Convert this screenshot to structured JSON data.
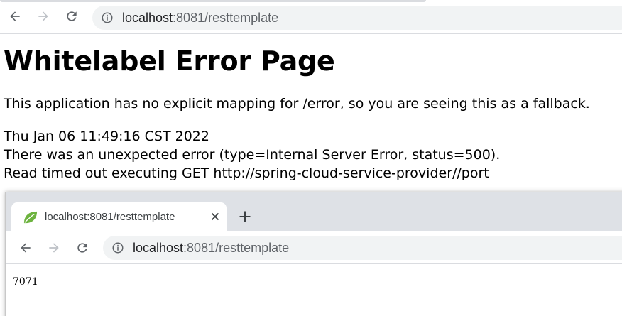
{
  "browser": {
    "url_host": "localhost",
    "url_rest": ":8081/resttemplate"
  },
  "page": {
    "title": "Whitelabel Error Page",
    "intro": "This application has no explicit mapping for /error, so you are seeing this as a fallback.",
    "timestamp": "Thu Jan 06 11:49:16 CST 2022",
    "error_line": "There was an unexpected error (type=Internal Server Error, status=500).",
    "message": "Read timed out executing GET http://spring-cloud-service-provider//port"
  },
  "second_window": {
    "tab_title": "localhost:8081/resttemplate",
    "url_host": "localhost",
    "url_rest": ":8081/resttemplate",
    "body_text": "7071"
  },
  "colors": {
    "icon": "#5f6368",
    "icon_disabled": "#bdc1c6",
    "omnibox": "#f1f3f4",
    "tabstrip": "#dee1e6",
    "spring_leaf": "#6db33f"
  },
  "icons": [
    "back-arrow-icon",
    "forward-arrow-icon",
    "reload-icon",
    "info-icon",
    "spring-leaf-icon",
    "close-icon",
    "plus-icon"
  ]
}
